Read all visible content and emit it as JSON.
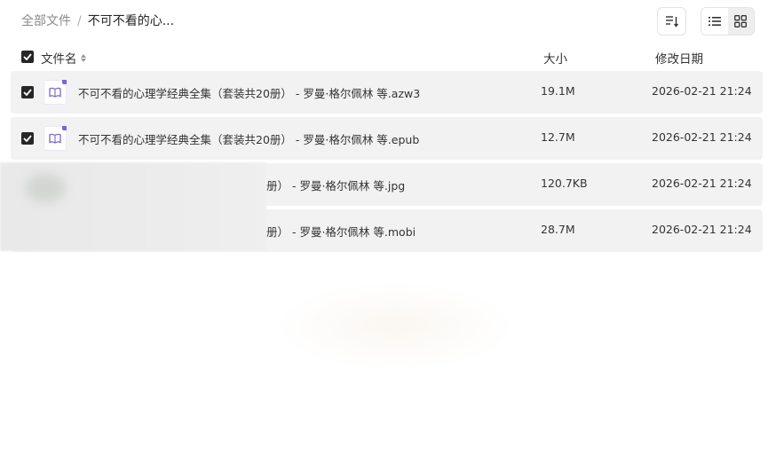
{
  "breadcrumb": {
    "root": "全部文件",
    "separator": "/",
    "current": "不可不看的心..."
  },
  "toolbar": {
    "sort_icon": "sort-list-icon",
    "list_view_icon": "list-view-icon",
    "grid_view_icon": "grid-view-icon"
  },
  "table": {
    "columns": {
      "name": "文件名",
      "size": "大小",
      "date": "修改日期"
    },
    "rows": [
      {
        "name": "不可不看的心理学经典全集（套装共20册） - 罗曼·格尔佩林 等.azw3",
        "size": "19.1M",
        "date": "2026-02-21 21:24",
        "checked": true,
        "icon": "ebook-icon"
      },
      {
        "name": "不可不看的心理学经典全集（套装共20册） - 罗曼·格尔佩林 等.epub",
        "size": "12.7M",
        "date": "2026-02-21 21:24",
        "checked": true,
        "icon": "ebook-icon"
      },
      {
        "name": "册） - 罗曼·格尔佩林 等.jpg",
        "size": "120.7KB",
        "date": "2026-02-21 21:24",
        "checked": false,
        "icon": "image-icon"
      },
      {
        "name": "册） - 罗曼·格尔佩林 等.mobi",
        "size": "28.7M",
        "date": "2026-02-21 21:24",
        "checked": false,
        "icon": "ebook-icon"
      }
    ]
  },
  "colors": {
    "row_background": "#f2f2f2",
    "checkbox": "#262626",
    "icon_accent": "#7d63d6"
  }
}
